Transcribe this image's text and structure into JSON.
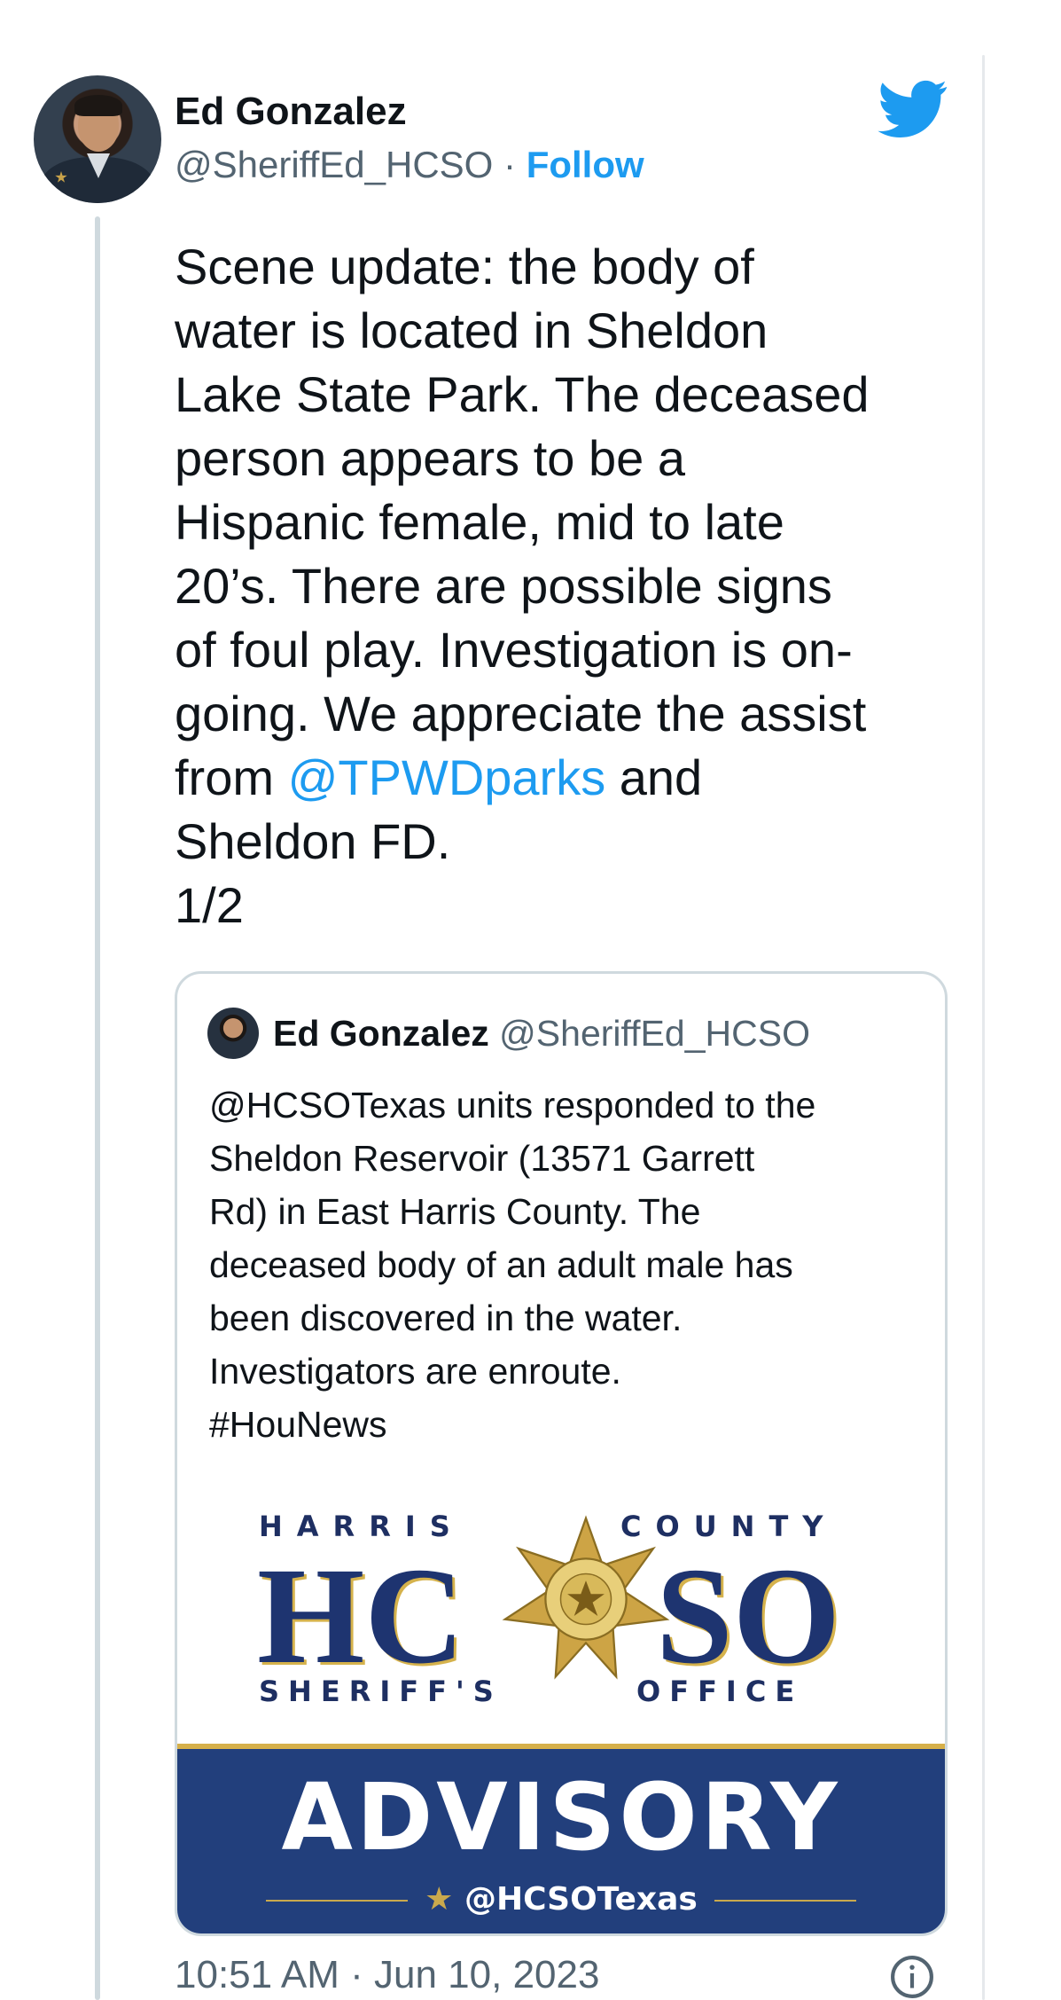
{
  "author": {
    "name": "Ed Gonzalez",
    "handle": "@SheriffEd_HCSO",
    "separator": "·",
    "follow_label": "Follow"
  },
  "tweet": {
    "text_before_mention": "Scene update: the body of\nwater is located in Sheldon\nLake State Park. The deceased\nperson appears to be a\nHispanic female, mid to late\n20’s. There are possible signs\nof foul play. Investigation is on-\ngoing. We appreciate the assist\nfrom ",
    "mention": "@TPWDparks",
    "text_after_mention": " and\nSheldon FD.\n1/2"
  },
  "quoted_tweet": {
    "name": "Ed Gonzalez",
    "handle": "@SheriffEd_HCSO",
    "text": "@HCSOTexas units responded to the\nSheldon Reservoir (13571 Garrett\nRd) in East Harris County. The\ndeceased body of an adult male has\nbeen discovered in the water.\nInvestigators are enroute.\n#HouNews",
    "banner": {
      "top_left": "HARRIS",
      "top_right": "COUNTY",
      "big_left": "HC",
      "big_right": "SO",
      "bottom_left": "SHERIFF'S",
      "bottom_right": "OFFICE",
      "advisory": "ADVISORY",
      "account": "@HCSOTexas"
    }
  },
  "timestamp": "10:51 AM · Jun 10, 2023",
  "icons": {
    "brand": "twitter-bird-icon",
    "info": "info-icon",
    "seal": "sheriff-star-icon"
  },
  "colors": {
    "link": "#1d9bf0",
    "secondary_text": "#536471",
    "hcso_navy": "#223f7c",
    "hcso_gold": "#d6b04a"
  }
}
